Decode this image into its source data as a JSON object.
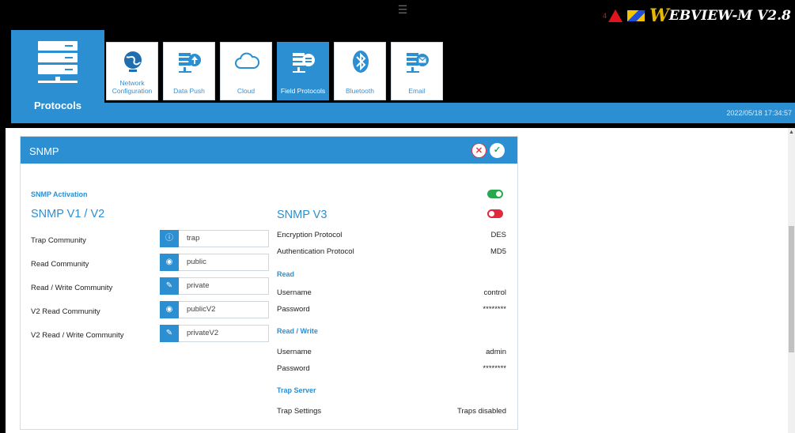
{
  "header": {
    "product_name": "EBVIEW-M V2.8",
    "logo_w": "W",
    "alert_small": "4",
    "datetime": "2022/05/18 17:34:57"
  },
  "sidebar": {
    "section_label": "Protocols"
  },
  "tabs": [
    {
      "label": "Network\nConfiguration",
      "icon": "globe-icon"
    },
    {
      "label": "Data Push",
      "icon": "upload-server-icon"
    },
    {
      "label": "Cloud",
      "icon": "cloud-icon"
    },
    {
      "label": "Field Protocols",
      "icon": "server-protocol-icon",
      "active": true
    },
    {
      "label": "Bluetooth",
      "icon": "bluetooth-icon"
    },
    {
      "label": "Email",
      "icon": "email-server-icon"
    }
  ],
  "panel": {
    "title": "SNMP",
    "activation_label": "SNMP Activation",
    "activation_on": true,
    "v1v2": {
      "title": "SNMP V1 / V2",
      "rows": [
        {
          "label": "Trap Community",
          "value": "trap",
          "icon": "info-icon"
        },
        {
          "label": "Read Community",
          "value": "public",
          "icon": "eye-icon"
        },
        {
          "label": "Read / Write Community",
          "value": "private",
          "icon": "edit-icon"
        },
        {
          "label": "V2 Read Community",
          "value": "publicV2",
          "icon": "eye-icon"
        },
        {
          "label": "V2 Read / Write Community",
          "value": "privateV2",
          "icon": "edit-icon"
        }
      ]
    },
    "v3": {
      "title": "SNMP V3",
      "enabled": false,
      "encryption_label": "Encryption Protocol",
      "encryption_value": "DES",
      "auth_label": "Authentication Protocol",
      "auth_value": "MD5",
      "read_heading": "Read",
      "read_username_label": "Username",
      "read_username_value": "control",
      "read_password_label": "Password",
      "read_password_value": "********",
      "rw_heading": "Read / Write",
      "rw_username_label": "Username",
      "rw_username_value": "admin",
      "rw_password_label": "Password",
      "rw_password_value": "********",
      "trap_heading": "Trap Server",
      "trap_label": "Trap Settings",
      "trap_value": "Traps disabled"
    }
  },
  "colors": {
    "accent": "#2b8fd1",
    "toggle_on": "#27a84f",
    "toggle_off": "#e2283b"
  }
}
